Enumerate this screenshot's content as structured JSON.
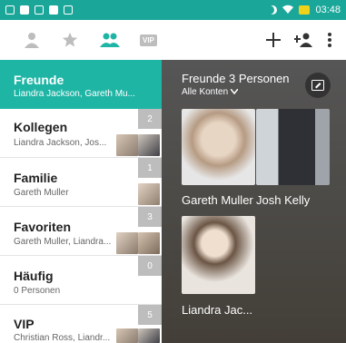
{
  "status_bar": {
    "time": "03:48"
  },
  "toolbar": {
    "vip_label": "VIP"
  },
  "list": {
    "items": [
      {
        "name": "Freunde",
        "members": "Liandra Jackson, Gareth Mu...",
        "count": ""
      },
      {
        "name": "Kollegen",
        "members": "Liandra Jackson, Jos...",
        "count": "2"
      },
      {
        "name": "Familie",
        "members": "Gareth Muller",
        "count": "1"
      },
      {
        "name": "Favoriten",
        "members": "Gareth Muller, Liandra...",
        "count": "3"
      },
      {
        "name": "Häufig",
        "members": "0 Personen",
        "count": "0"
      },
      {
        "name": "VIP",
        "members": "Christian Ross, Liandr...",
        "count": "5"
      }
    ]
  },
  "detail": {
    "title": "Freunde 3 Personen",
    "account_filter": "Alle Konten",
    "people": [
      {
        "name": "Gareth Muller"
      },
      {
        "name": "Josh Kelly"
      },
      {
        "name": "Liandra Jac..."
      }
    ]
  },
  "colors": {
    "accent": "#1fb5a5",
    "status": "#1aa79a",
    "count_bg": "#bdbdbd"
  }
}
